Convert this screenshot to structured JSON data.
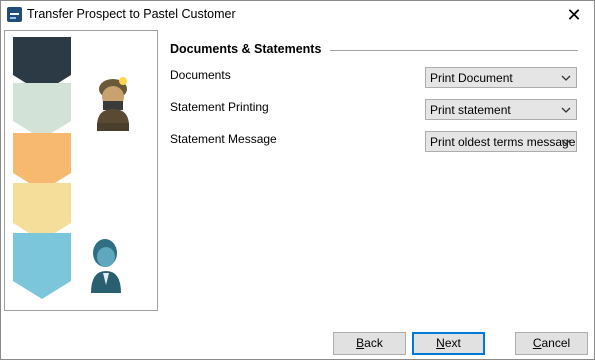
{
  "window": {
    "title": "Transfer Prospect to Pastel Customer",
    "close_glyph": "✕"
  },
  "icons": {
    "app": "app-icon",
    "close": "close-icon",
    "chevron": "chevron-down-icon",
    "miner": "miner-figure-icon",
    "businessman": "businessman-figure-icon"
  },
  "section": {
    "title": "Documents & Statements"
  },
  "fields": [
    {
      "label": "Documents",
      "value": "Print Document"
    },
    {
      "label": "Statement Printing",
      "value": "Print statement"
    },
    {
      "label": "Statement Message",
      "value": "Print oldest terms message"
    }
  ],
  "buttons": {
    "back": {
      "mnemonic": "B",
      "rest": "ack"
    },
    "next": {
      "mnemonic": "N",
      "rest": "ext"
    },
    "cancel": {
      "mnemonic": "C",
      "rest": "ancel"
    }
  },
  "colors": {
    "arrow_1": "#2c3a46",
    "arrow_2": "#d3e2d6",
    "arrow_3": "#f7b970",
    "arrow_4": "#f4de9a",
    "arrow_5": "#7cc6dc",
    "default_button_border": "#0078d7"
  }
}
